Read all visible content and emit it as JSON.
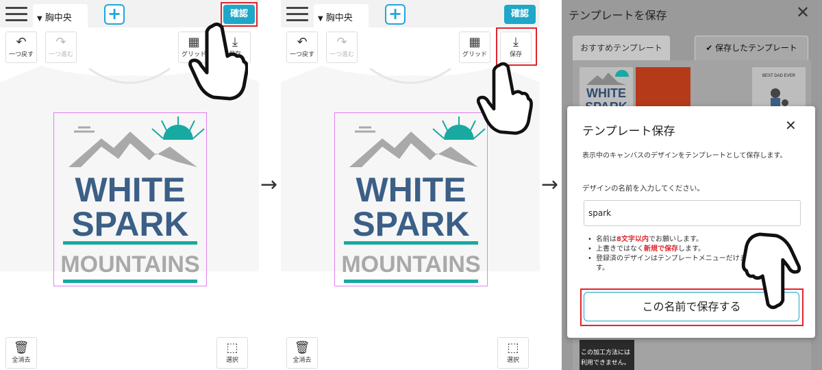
{
  "panels": [
    {
      "topbar": {
        "position_tab": "胸中央",
        "confirm_label": "確認"
      },
      "tools": {
        "undo_label": "一つ戻す",
        "redo_label": "一つ進む",
        "grid_label": "グリッド",
        "save_label": "保存"
      },
      "bottom": {
        "clear_label": "全消去",
        "select_label": "選択"
      }
    },
    {
      "topbar": {
        "position_tab": "胸中央",
        "confirm_label": "確認"
      },
      "tools": {
        "undo_label": "一つ戻す",
        "redo_label": "一つ進む",
        "grid_label": "グリッド",
        "save_label": "保存"
      },
      "bottom": {
        "clear_label": "全消去",
        "select_label": "選択"
      }
    }
  ],
  "design": {
    "line1": "WHITE",
    "line2": "SPARK",
    "line3": "MOUNTAINS"
  },
  "template_panel": {
    "title": "テンプレートを保存",
    "tab_recommended": "おすすめテンプレート",
    "tab_saved": "保存したテンプレート",
    "thumb_dad_text": "BEST DAD EVER",
    "bottom_note_line1": "この加工方法には",
    "bottom_note_line2": "利用できません。"
  },
  "modal": {
    "title": "テンプレート保存",
    "description": "表示中のキャンバスのデザインをテンプレートとして保存します。",
    "prompt": "デザインの名前を入力してください。",
    "input_value": "spark",
    "note1_pre": "名前は",
    "note1_red": "8文字以内",
    "note1_post": "でお願いします。",
    "note2_pre": "上書きではなく",
    "note2_red": "新規で保存",
    "note2_post": "します。",
    "note3": "登録済のデザインはテンプレートメニューだけます。",
    "save_button": "この名前で保存する"
  },
  "colors": {
    "accent": "#1ea7c8",
    "highlight": "#e0252d",
    "design_blue": "#3b5f86",
    "design_teal": "#17a9a2",
    "design_gray": "#a9a9a9"
  },
  "icons": [
    "menu-icon",
    "chevron-down-icon",
    "plus-icon",
    "undo-icon",
    "redo-icon",
    "grid-icon",
    "download-icon",
    "trash-icon",
    "select-icon",
    "close-icon",
    "check-icon",
    "pointing-hand-icon",
    "arrow-right-icon"
  ]
}
